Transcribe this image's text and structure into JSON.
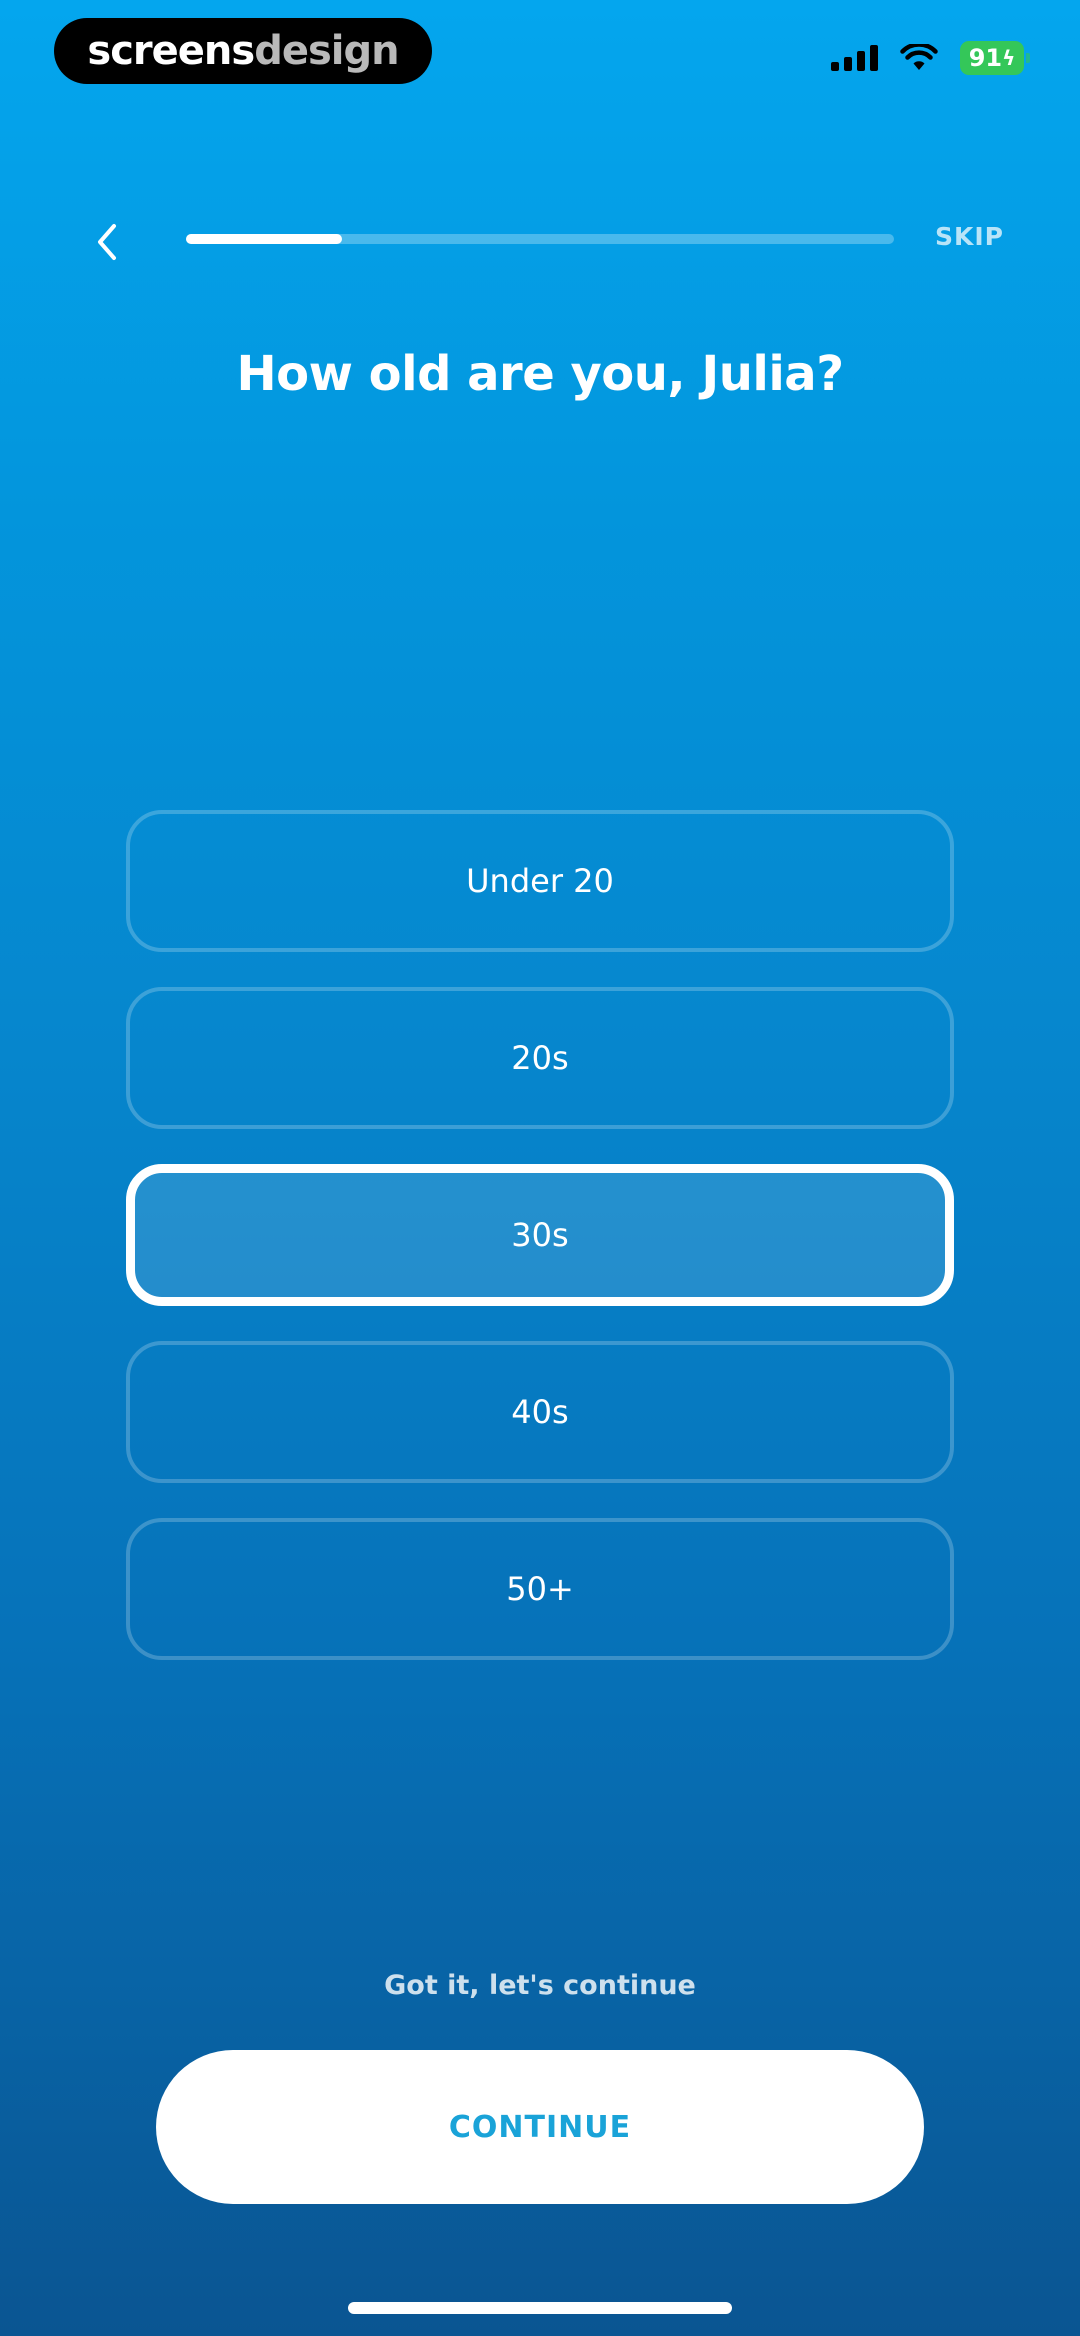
{
  "watermark": {
    "part1": "screens",
    "part2": "design"
  },
  "status_bar": {
    "battery": "91",
    "signal_icon": "signal-bars-icon",
    "wifi_icon": "wifi-icon"
  },
  "header": {
    "back_icon": "chevron-left-icon",
    "progress": 0.22,
    "skip_label": "SKIP"
  },
  "question": "How old are you, Julia?",
  "options": [
    {
      "label": "Under 20",
      "selected": false
    },
    {
      "label": "20s",
      "selected": false
    },
    {
      "label": "30s",
      "selected": true
    },
    {
      "label": "40s",
      "selected": false
    },
    {
      "label": "50+",
      "selected": false
    }
  ],
  "footer": {
    "hint": "Got it, let's continue",
    "continue_label": "CONTINUE"
  },
  "colors": {
    "accent": "#1aa3d8",
    "background_top": "#04a6ee",
    "background_bottom": "#0a5592"
  }
}
